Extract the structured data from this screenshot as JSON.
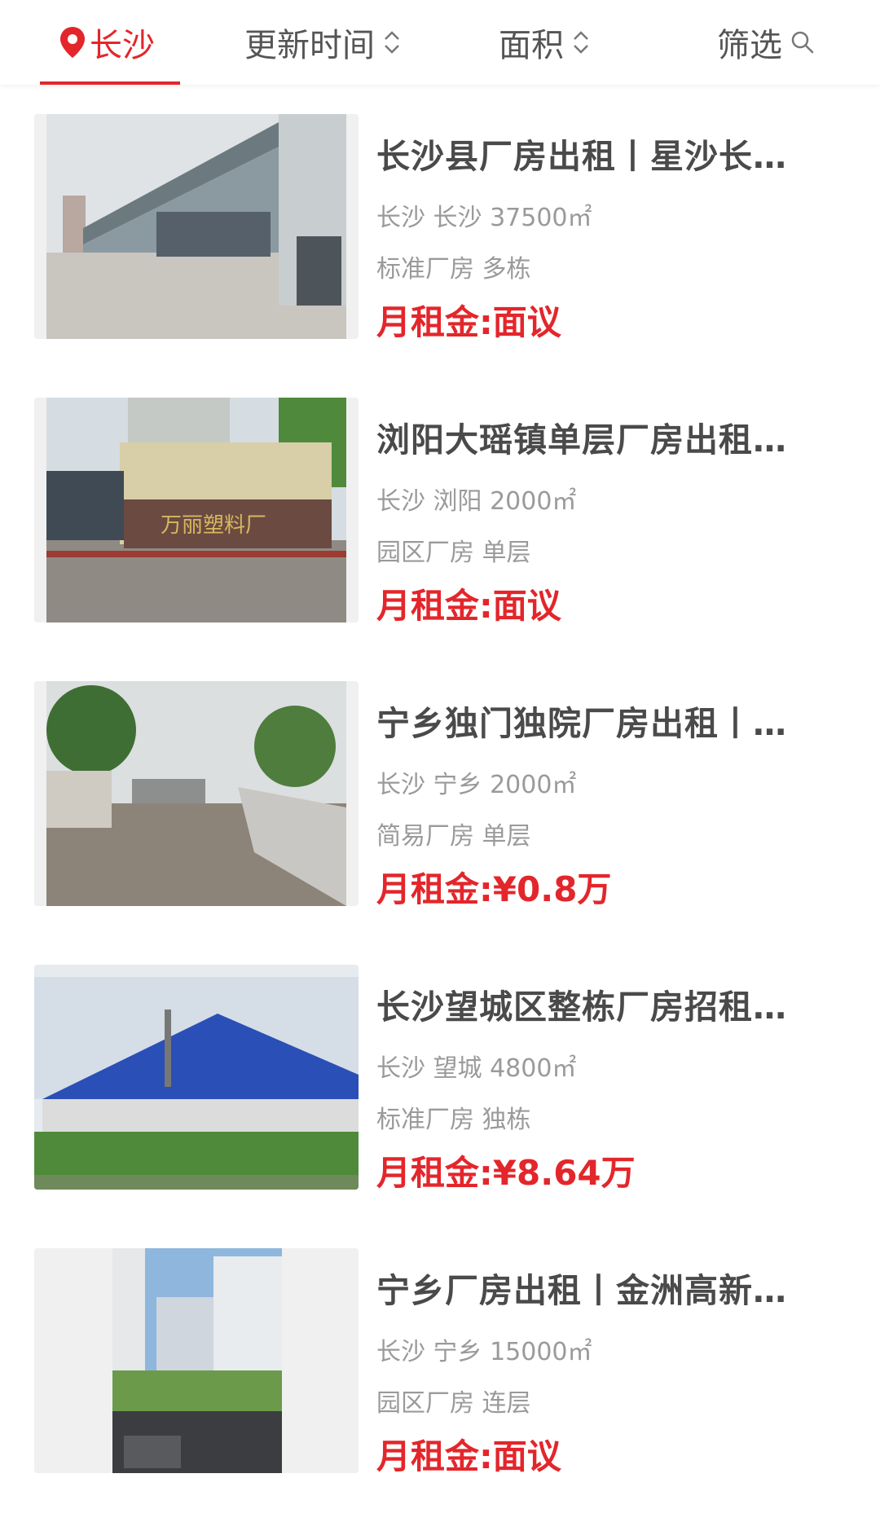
{
  "filters": {
    "city": "长沙",
    "update_time": "更新时间",
    "area": "面积",
    "filter": "筛选"
  },
  "icons": {
    "city": "location-pin-icon",
    "sort": "up-down-chevron-icon",
    "filter": "search-icon"
  },
  "accent_color": "#e3262b",
  "listings": [
    {
      "title": "长沙县厂房出租丨星沙长…",
      "location": "长沙 长沙 37500㎡",
      "type": "标准厂房 多栋",
      "price_label": "月租金:",
      "price_value": "面议"
    },
    {
      "title": "浏阳大瑶镇单层厂房出租…",
      "location": "长沙 浏阳 2000㎡",
      "type": "园区厂房 单层",
      "price_label": "月租金:",
      "price_value": "面议",
      "sign_text": "万丽塑料厂"
    },
    {
      "title": "宁乡独门独院厂房出租丨…",
      "location": "长沙 宁乡 2000㎡",
      "type": "简易厂房 单层",
      "price_label": "月租金:",
      "price_value": "¥0.8万"
    },
    {
      "title": "长沙望城区整栋厂房招租…",
      "location": "长沙 望城 4800㎡",
      "type": "标准厂房 独栋",
      "price_label": "月租金:",
      "price_value": "¥8.64万"
    },
    {
      "title": "宁乡厂房出租丨金洲高新…",
      "location": "长沙 宁乡 15000㎡",
      "type": "园区厂房 连层",
      "price_label": "月租金:",
      "price_value": "面议"
    }
  ]
}
